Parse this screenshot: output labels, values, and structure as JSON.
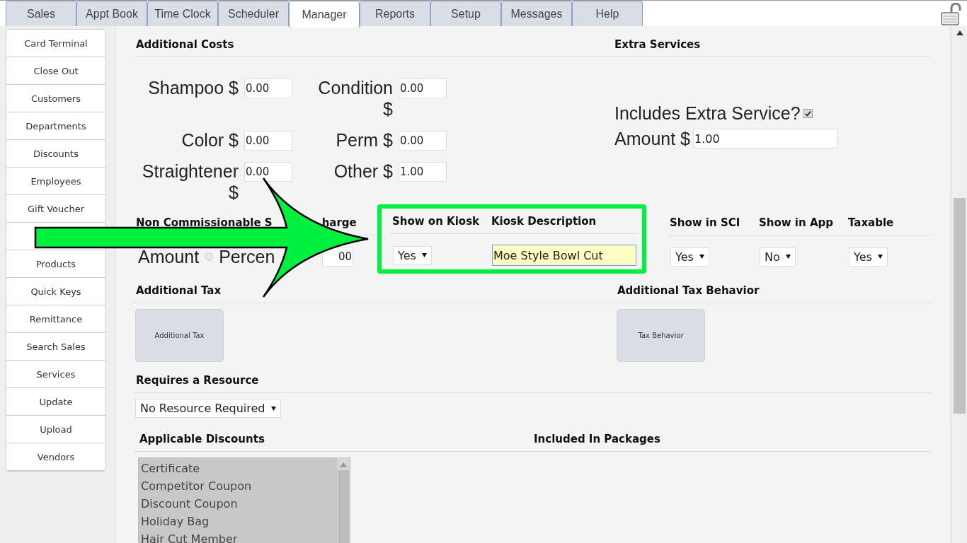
{
  "tabs": [
    {
      "label": "Sales",
      "selected": false
    },
    {
      "label": "Appt Book",
      "selected": false
    },
    {
      "label": "Time Clock",
      "selected": false
    },
    {
      "label": "Scheduler",
      "selected": false
    },
    {
      "label": "Manager",
      "selected": true
    },
    {
      "label": "Reports",
      "selected": false
    },
    {
      "label": "Setup",
      "selected": false
    },
    {
      "label": "Messages",
      "selected": false
    },
    {
      "label": "Help",
      "selected": false
    }
  ],
  "sidebar": [
    {
      "kind": "item",
      "label": "Card Terminal"
    },
    {
      "kind": "item",
      "label": "Close Out"
    },
    {
      "kind": "item",
      "label": "Customers"
    },
    {
      "kind": "item",
      "label": "Departments"
    },
    {
      "kind": "item",
      "label": "Discounts"
    },
    {
      "kind": "item",
      "label": "Employees"
    },
    {
      "kind": "item",
      "label": "Gift Voucher"
    },
    {
      "kind": "covered"
    },
    {
      "kind": "item",
      "label": "Products"
    },
    {
      "kind": "item",
      "label": "Quick Keys"
    },
    {
      "kind": "item",
      "label": "Remittance"
    },
    {
      "kind": "item",
      "label": "Search Sales"
    },
    {
      "kind": "item",
      "label": "Services"
    },
    {
      "kind": "item",
      "label": "Update"
    },
    {
      "kind": "item",
      "label": "Upload"
    },
    {
      "kind": "item",
      "label": "Vendors"
    }
  ],
  "additional_costs": {
    "title": "Additional Costs",
    "fields": [
      {
        "label": "Shampoo $",
        "value": "0.00"
      },
      {
        "label": "Condition $",
        "value": "0.00"
      },
      {
        "label": "Color $",
        "value": "0.00"
      },
      {
        "label": "Perm $",
        "value": "0.00"
      },
      {
        "label": "Straightener $",
        "value": "0.00"
      },
      {
        "label": "Other $",
        "value": "1.00"
      }
    ]
  },
  "extra_services": {
    "title": "Extra Services",
    "checkbox_label": "Includes Extra Service?",
    "checked": true,
    "amount_label": "Amount $",
    "amount_value": "1.00"
  },
  "surcharge": {
    "title_start": "Non Commissionable S",
    "title_end": "harge",
    "amount_label": "Amount",
    "amount_selected": false,
    "percent_label": "Percen",
    "value": "00"
  },
  "highlighted_columns": [
    {
      "heading": "Show on Kiosk",
      "kind": "select",
      "value": "Yes"
    },
    {
      "heading": "Kiosk Description",
      "kind": "text",
      "value": "Moe Style Bowl Cut"
    }
  ],
  "columns": [
    {
      "heading": "Show in SCI",
      "kind": "select",
      "value": "Yes"
    },
    {
      "heading": "Show in App",
      "kind": "select",
      "value": "No"
    },
    {
      "heading": "Taxable",
      "kind": "select",
      "value": "Yes"
    }
  ],
  "additional_tax": {
    "title": "Additional Tax",
    "button": "Additional Tax"
  },
  "tax_behavior": {
    "title": "Additional Tax Behavior",
    "button": "Tax Behavior"
  },
  "resource": {
    "title": "Requires a Resource",
    "value": "No Resource Required"
  },
  "discounts": {
    "title": "Applicable Discounts",
    "items": [
      "Certificate",
      "Competitor Coupon",
      "Discount Coupon",
      "Holiday Bag",
      "Hair Cut Member"
    ]
  },
  "packages": {
    "title": "Included In Packages"
  }
}
